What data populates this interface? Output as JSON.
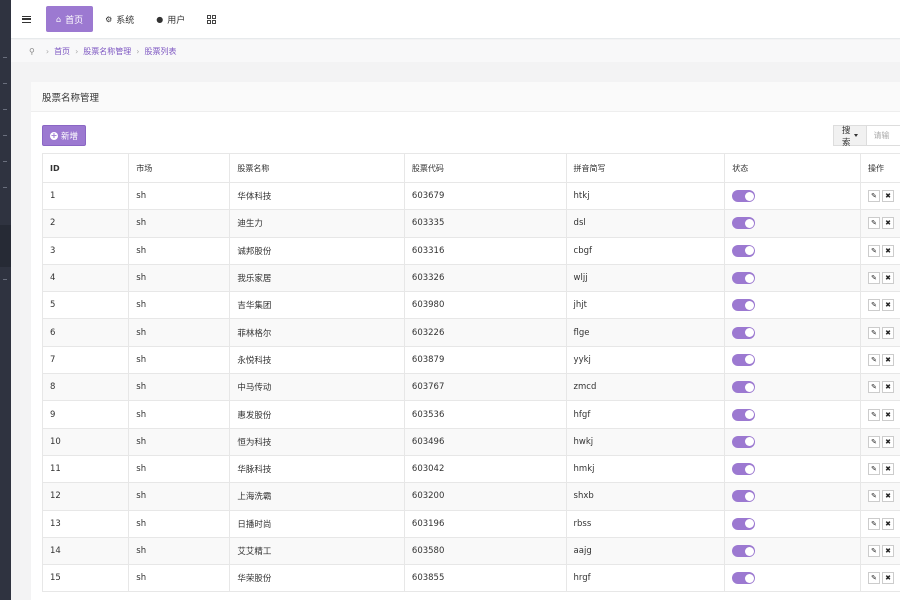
{
  "topnav": {
    "items": [
      {
        "label": "首页",
        "icon": "home-icon",
        "active": true
      },
      {
        "label": "系统",
        "icon": "gear-icon",
        "active": false
      },
      {
        "label": "用户",
        "icon": "user-icon",
        "active": false
      }
    ]
  },
  "breadcrumb": {
    "items": [
      "首页",
      "股票名称管理",
      "股票列表"
    ]
  },
  "panel": {
    "title": "股票名称管理"
  },
  "toolbar": {
    "add_label": "新增",
    "search_label": "搜索",
    "search_placeholder": "请输"
  },
  "table": {
    "headers": [
      "ID",
      "市场",
      "股票名称",
      "股票代码",
      "拼音简写",
      "状态",
      "操作"
    ],
    "rows": [
      {
        "id": "1",
        "market": "sh",
        "name": "华体科技",
        "code": "603679",
        "pinyin": "htkj"
      },
      {
        "id": "2",
        "market": "sh",
        "name": "迪生力",
        "code": "603335",
        "pinyin": "dsl"
      },
      {
        "id": "3",
        "market": "sh",
        "name": "诚邦股份",
        "code": "603316",
        "pinyin": "cbgf"
      },
      {
        "id": "4",
        "market": "sh",
        "name": "我乐家居",
        "code": "603326",
        "pinyin": "wljj"
      },
      {
        "id": "5",
        "market": "sh",
        "name": "吉华集团",
        "code": "603980",
        "pinyin": "jhjt"
      },
      {
        "id": "6",
        "market": "sh",
        "name": "菲林格尔",
        "code": "603226",
        "pinyin": "flge"
      },
      {
        "id": "7",
        "market": "sh",
        "name": "永悦科技",
        "code": "603879",
        "pinyin": "yykj"
      },
      {
        "id": "8",
        "market": "sh",
        "name": "中马传动",
        "code": "603767",
        "pinyin": "zmcd"
      },
      {
        "id": "9",
        "market": "sh",
        "name": "惠发股份",
        "code": "603536",
        "pinyin": "hfgf"
      },
      {
        "id": "10",
        "market": "sh",
        "name": "恒为科技",
        "code": "603496",
        "pinyin": "hwkj"
      },
      {
        "id": "11",
        "market": "sh",
        "name": "华脉科技",
        "code": "603042",
        "pinyin": "hmkj"
      },
      {
        "id": "12",
        "market": "sh",
        "name": "上海洗霸",
        "code": "603200",
        "pinyin": "shxb"
      },
      {
        "id": "13",
        "market": "sh",
        "name": "日播时尚",
        "code": "603196",
        "pinyin": "rbss"
      },
      {
        "id": "14",
        "market": "sh",
        "name": "艾艾精工",
        "code": "603580",
        "pinyin": "aajg"
      },
      {
        "id": "15",
        "market": "sh",
        "name": "华荣股份",
        "code": "603855",
        "pinyin": "hrgf"
      }
    ]
  },
  "colors": {
    "accent": "#9c79d1",
    "sidebar": "#2f3340",
    "link": "#7e57c2"
  }
}
